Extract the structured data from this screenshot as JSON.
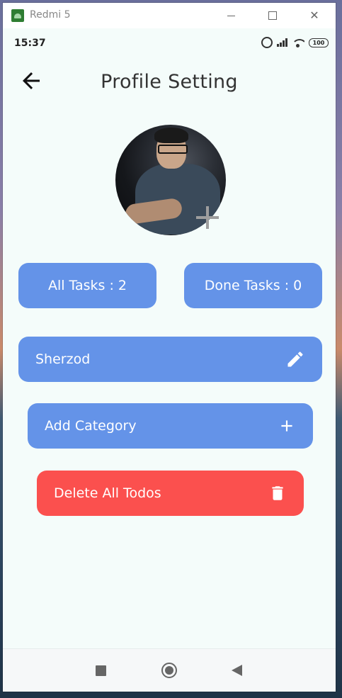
{
  "window": {
    "title": "Redmi 5"
  },
  "statusbar": {
    "time": "15:37",
    "battery": "100"
  },
  "appbar": {
    "title": "Profile Setting"
  },
  "stats": {
    "all_tasks": "All Tasks : 2",
    "done_tasks": "Done Tasks : 0"
  },
  "profile": {
    "name": "Sherzod"
  },
  "actions": {
    "add_category": "Add Category",
    "delete_all": "Delete All Todos"
  },
  "colors": {
    "primary": "#6493e8",
    "danger": "#fb504e",
    "background": "#f4fcfa"
  },
  "icons": [
    "back-arrow-icon",
    "pencil-icon",
    "plus-icon",
    "trash-icon",
    "add-photo-plus-icon"
  ]
}
